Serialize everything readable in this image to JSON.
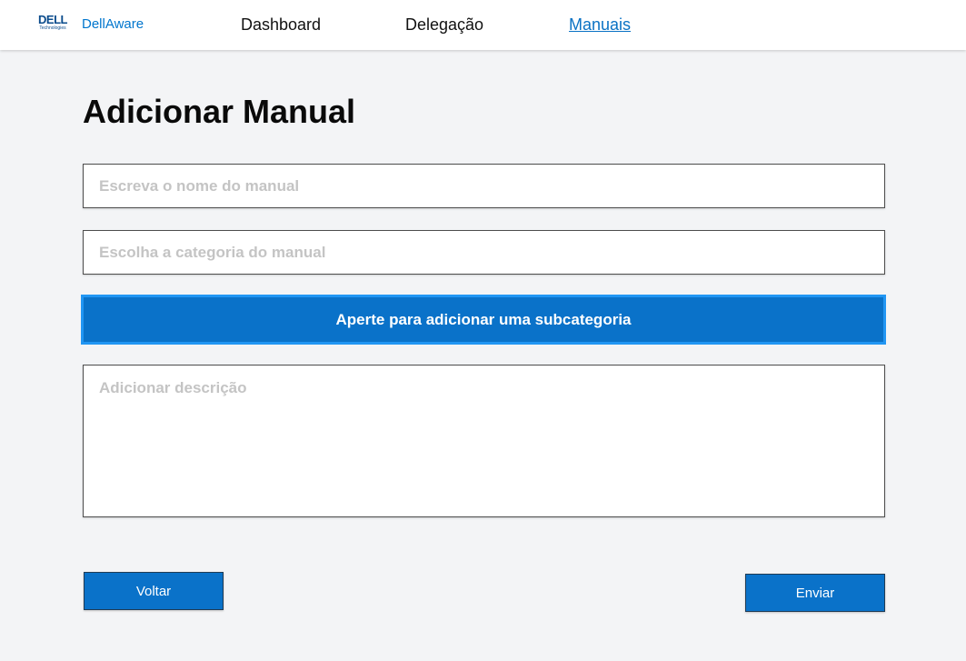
{
  "header": {
    "logo_text": "DELL",
    "logo_subtext": "Technologies",
    "app_name": "DellAware",
    "nav": {
      "dashboard": "Dashboard",
      "delegacao": "Delegação",
      "manuais": "Manuais"
    },
    "active_nav": "Manuais"
  },
  "page": {
    "title": "Adicionar Manual"
  },
  "form": {
    "name_placeholder": "Escreva o nome do manual",
    "name_value": "",
    "category_placeholder": "Escolha a categoria do manual",
    "category_value": "",
    "subcategory_button": "Aperte para adicionar uma subcategoria",
    "description_placeholder": "Adicionar descrição",
    "description_value": ""
  },
  "actions": {
    "back_label": "Voltar",
    "send_label": "Enviar"
  },
  "colors": {
    "accent": "#0a72c9",
    "accent_border": "#2196f3",
    "active_link": "#0a72c4",
    "background": "#f3f4f6"
  }
}
